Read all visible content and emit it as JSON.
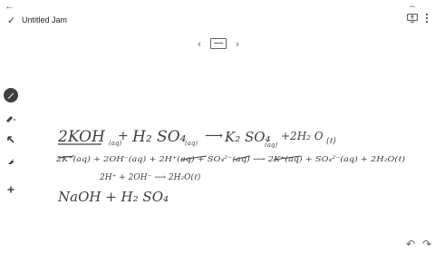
{
  "window": {
    "title": "Untitled Jam"
  },
  "toolbar": {
    "back_icon": "back-arrow-icon",
    "minimize_icon": "minimize-icon",
    "check_icon": "check-icon",
    "present_icon": "present-to-display-icon",
    "more_icon": "more-vert-icon"
  },
  "pager": {
    "prev": "‹",
    "next": "›",
    "frame_icon": "frame-icon"
  },
  "tools": [
    "pen-icon",
    "marker-icon",
    "select-icon",
    "laser-icon",
    "add-icon"
  ],
  "bottom": {
    "undo_icon": "undo-icon",
    "redo_icon": "redo-icon"
  },
  "board": {
    "line1_left": "2KOH",
    "line1_left_sub": "(aq)",
    "line1_plus": "+",
    "line1_acid": "H₂ SO₄",
    "line1_acid_sub": "(aq)",
    "line1_arrow": "⟶",
    "line1_product": "K₂ SO₄",
    "line1_product_sub": "(aq)",
    "line1_water": "+2H₂ O",
    "line1_water_sub": "(ℓ)",
    "line2": "2K⁺(aq) + 2OH⁻(aq) + 2H⁺(aq) + SO₄²⁻(aq) ⟶ 2K⁺(aq) + SO₄²⁻(aq) + 2H₂O(ℓ)",
    "line3": "2H⁺ + 2OH⁻ ⟶ 2H₂O(ℓ)",
    "line4": "NaOH + H₂ SO₄"
  }
}
